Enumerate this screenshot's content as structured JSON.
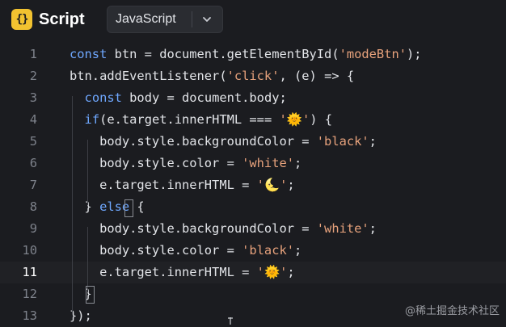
{
  "app": {
    "icon_glyph": "{}",
    "icon_name": "curly-braces-icon",
    "title": "Script"
  },
  "language_select": {
    "value": "JavaScript",
    "chevron_icon": "chevron-down-icon"
  },
  "editor": {
    "active_line": 11,
    "lines": [
      {
        "n": "1",
        "tokens": [
          [
            "kw",
            "const"
          ],
          [
            "id",
            " btn = document.getElementById("
          ],
          [
            "str",
            "'modeBtn'"
          ],
          [
            "id",
            ");"
          ]
        ]
      },
      {
        "n": "2",
        "tokens": [
          [
            "id",
            "btn.addEventListener("
          ],
          [
            "str",
            "'click'"
          ],
          [
            "id",
            ", (e) => {"
          ]
        ]
      },
      {
        "n": "3",
        "tokens": [
          [
            "id",
            "  "
          ],
          [
            "kw",
            "const"
          ],
          [
            "id",
            " body = document.body;"
          ]
        ]
      },
      {
        "n": "4",
        "tokens": [
          [
            "id",
            "  "
          ],
          [
            "kw",
            "if"
          ],
          [
            "id",
            "(e.target.innerHTML === "
          ],
          [
            "str",
            "'"
          ],
          [
            "emoji",
            "🌞"
          ],
          [
            "str",
            "'"
          ],
          [
            "id",
            ") {"
          ]
        ]
      },
      {
        "n": "5",
        "tokens": [
          [
            "id",
            "    body.style.backgroundColor = "
          ],
          [
            "str",
            "'black'"
          ],
          [
            "id",
            ";"
          ]
        ]
      },
      {
        "n": "6",
        "tokens": [
          [
            "id",
            "    body.style.color = "
          ],
          [
            "str",
            "'white'"
          ],
          [
            "id",
            ";"
          ]
        ]
      },
      {
        "n": "7",
        "tokens": [
          [
            "id",
            "    e.target.innerHTML = "
          ],
          [
            "str",
            "'"
          ],
          [
            "emoji",
            "🌜"
          ],
          [
            "str",
            "'"
          ],
          [
            "id",
            ";"
          ]
        ]
      },
      {
        "n": "8",
        "tokens": [
          [
            "id",
            "  } "
          ],
          [
            "kw",
            "else"
          ],
          [
            "id",
            " {"
          ]
        ]
      },
      {
        "n": "9",
        "tokens": [
          [
            "id",
            "    body.style.backgroundColor = "
          ],
          [
            "str",
            "'white'"
          ],
          [
            "id",
            ";"
          ]
        ]
      },
      {
        "n": "10",
        "tokens": [
          [
            "id",
            "    body.style.color = "
          ],
          [
            "str",
            "'black'"
          ],
          [
            "id",
            ";"
          ]
        ]
      },
      {
        "n": "11",
        "tokens": [
          [
            "id",
            "    e.target.innerHTML = "
          ],
          [
            "str",
            "'"
          ],
          [
            "emoji",
            "🌞"
          ],
          [
            "str",
            "'"
          ],
          [
            "id",
            ";"
          ]
        ]
      },
      {
        "n": "12",
        "tokens": [
          [
            "id",
            "  }"
          ]
        ]
      },
      {
        "n": "13",
        "tokens": [
          [
            "id",
            "});"
          ]
        ]
      }
    ]
  },
  "watermark": "@稀土掘金技术社区",
  "colors": {
    "background": "#1b1c20",
    "keyword": "#6fa8ff",
    "string": "#e7a27c",
    "identifier": "#e2e4e8",
    "line_number": "#7e828b",
    "accent": "#f2c230"
  }
}
